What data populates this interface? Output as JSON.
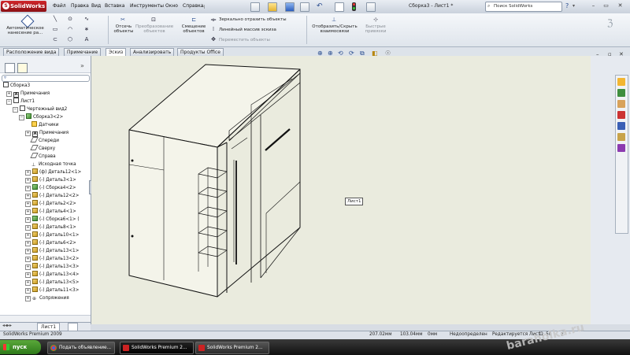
{
  "app": {
    "logo": "SolidWorks",
    "window_title": "Сборка3 - Лист1 *"
  },
  "menu": [
    "Файл",
    "Правка",
    "Вид",
    "Вставка",
    "Инструменты",
    "Окно",
    "Справка"
  ],
  "search": {
    "value": "Поиск SolidWorks"
  },
  "ribbon": {
    "auto_annotation": "Автоматическое нанесение ра...",
    "section_view": "Отсечь объекты",
    "convert_entities": "Преобразование объектов",
    "offset_entities": "Смещение объектов",
    "mirror_entities": "Зеркально отразить объекты",
    "linear_pattern": "Линейный массив эскиза",
    "move_entities": "Переместить объекты",
    "display_relations": "Отобразить/Скрыть взаимосвязи",
    "quick_snaps": "Быстрые привязки"
  },
  "tabs": [
    "Расположение вида",
    "Примечание",
    "Эскиз",
    "Анализировать",
    "Продукты Office"
  ],
  "active_tab": "Эскиз",
  "tree": {
    "root": "Сборка3",
    "annotations": "Примечания",
    "sheet": "Лист1",
    "drawing_view": "Чертежный вид2",
    "assembly": "Сборка3<2>",
    "sensors": "Датчики",
    "notes": "Примечания",
    "front": "Спереди",
    "top": "Сверху",
    "right": "Справа",
    "origin": "Исходная точка",
    "parts": [
      "(ф) Деталь12<1>",
      "(-) Деталь3<1>",
      "(-) Сборка4<2>",
      "(-) Деталь12<2>",
      "(-) Деталь2<2>",
      "(-) Деталь4<1>",
      "(-) Сборка6<1> (",
      "(-) Деталь8<1>",
      "(-) Деталь10<1>",
      "(-) Деталь6<2>",
      "(-) Деталь13<1>",
      "(-) Деталь13<2>",
      "(-) Деталь13<3>",
      "(-) Деталь13<4>",
      "(-) Деталь13<5>",
      "(-) Деталь11<3>"
    ],
    "mates": "Сопряжения"
  },
  "sheet_tab": "Лист1",
  "canvas": {
    "sheet_label": "Лист1"
  },
  "status": {
    "product": "SolidWorks Premium 2009",
    "x": "207.02мм",
    "y": "103.04мм",
    "z": "0мм",
    "state": "Недоопределен",
    "editing": "Редактируется Лист1",
    "scale": "1 : 50"
  },
  "taskbar": {
    "start": "пуск",
    "buttons": [
      "Подать объявление...",
      "SolidWorks Premium 2...",
      "SolidWorks Premium 2..."
    ],
    "watermark": "baraholka.ru"
  }
}
